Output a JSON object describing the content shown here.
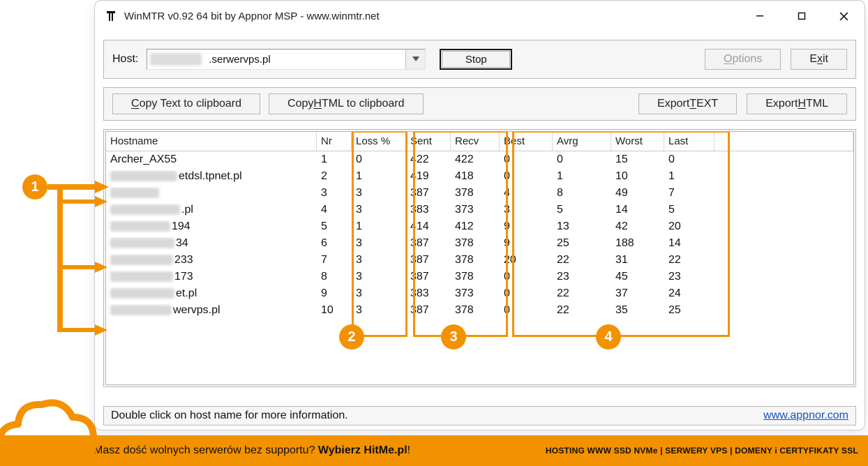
{
  "window": {
    "title": "WinMTR v0.92 64 bit by Appnor MSP - www.winmtr.net"
  },
  "row1": {
    "host_label": "Host:",
    "host_suffix": ".serwervps.pl",
    "stop": "Stop",
    "options_pre": "O",
    "options_rest": "ptions",
    "exit_pre": "E",
    "exit_u": "x",
    "exit_rest": "it"
  },
  "row2": {
    "copy_text_pre": "C",
    "copy_text_rest": "opy Text to clipboard",
    "copy_html_pre": "Copy ",
    "copy_html_u": "H",
    "copy_html_rest": "TML to clipboard",
    "export_text_pre": "Export ",
    "export_text_u": "T",
    "export_text_rest": "EXT",
    "export_html_pre": "Export ",
    "export_html_u": "H",
    "export_html_rest": "TML"
  },
  "table": {
    "headers": {
      "hostname": "Hostname",
      "nr": "Nr",
      "loss": "Loss %",
      "sent": "Sent",
      "recv": "Recv",
      "best": "Best",
      "avrg": "Avrg",
      "worst": "Worst",
      "last": "Last"
    },
    "rows": [
      {
        "host_clear": "Archer_AX55",
        "host_suffix": "",
        "blur_w": 0,
        "nr": "1",
        "loss": "0",
        "sent": "422",
        "recv": "422",
        "best": "0",
        "avrg": "0",
        "worst": "15",
        "last": "0"
      },
      {
        "host_clear": "",
        "host_suffix": "etdsl.tpnet.pl",
        "blur_w": 96,
        "nr": "2",
        "loss": "1",
        "sent": "419",
        "recv": "418",
        "best": "0",
        "avrg": "1",
        "worst": "10",
        "last": "1"
      },
      {
        "host_clear": "",
        "host_suffix": "",
        "blur_w": 70,
        "nr": "3",
        "loss": "3",
        "sent": "387",
        "recv": "378",
        "best": "4",
        "avrg": "8",
        "worst": "49",
        "last": "7"
      },
      {
        "host_clear": "",
        "host_suffix": ".pl",
        "blur_w": 100,
        "nr": "4",
        "loss": "3",
        "sent": "383",
        "recv": "373",
        "best": "3",
        "avrg": "5",
        "worst": "14",
        "last": "5"
      },
      {
        "host_clear": "",
        "host_suffix": "194",
        "blur_w": 86,
        "nr": "5",
        "loss": "1",
        "sent": "414",
        "recv": "412",
        "best": "9",
        "avrg": "13",
        "worst": "42",
        "last": "20"
      },
      {
        "host_clear": "",
        "host_suffix": "34",
        "blur_w": 92,
        "nr": "6",
        "loss": "3",
        "sent": "387",
        "recv": "378",
        "best": "9",
        "avrg": "25",
        "worst": "188",
        "last": "14"
      },
      {
        "host_clear": "",
        "host_suffix": "233",
        "blur_w": 90,
        "nr": "7",
        "loss": "3",
        "sent": "387",
        "recv": "378",
        "best": "20",
        "avrg": "22",
        "worst": "31",
        "last": "22"
      },
      {
        "host_clear": "",
        "host_suffix": "173",
        "blur_w": 90,
        "nr": "8",
        "loss": "3",
        "sent": "387",
        "recv": "378",
        "best": "0",
        "avrg": "23",
        "worst": "45",
        "last": "23"
      },
      {
        "host_clear": "",
        "host_suffix": "et.pl",
        "blur_w": 92,
        "nr": "9",
        "loss": "3",
        "sent": "383",
        "recv": "373",
        "best": "0",
        "avrg": "22",
        "worst": "37",
        "last": "24"
      },
      {
        "host_clear": "",
        "host_suffix": "wervps.pl",
        "blur_w": 88,
        "nr": "10",
        "loss": "3",
        "sent": "387",
        "recv": "378",
        "best": "0",
        "avrg": "22",
        "worst": "35",
        "last": "25"
      }
    ]
  },
  "annotations": {
    "b1": "1",
    "b2": "2",
    "b3": "3",
    "b4": "4"
  },
  "statusbar": {
    "text": "Double click on host name for more information.",
    "link": "www.appnor.com"
  },
  "banner": {
    "lead_plain": "Masz dość wolnych serwerów bez supportu? ",
    "lead_bold": "Wybierz HitMe.pl",
    "lead_tail": "!",
    "right": "HOSTING WWW SSD NVMe | SERWERY VPS | DOMENY i CERTYFIKATY SSL"
  }
}
